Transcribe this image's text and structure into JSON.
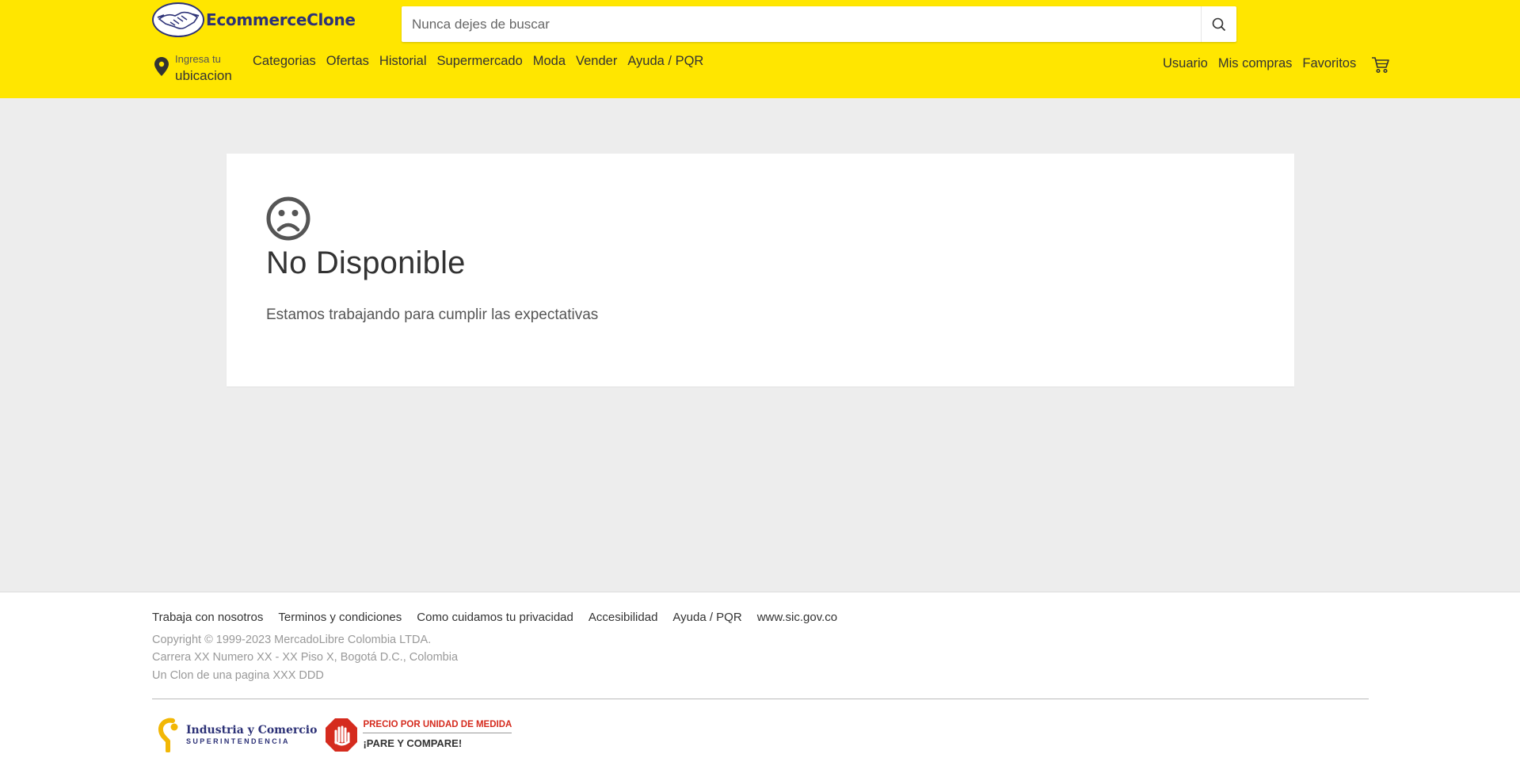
{
  "header": {
    "brand": "EcommerceClone",
    "search_placeholder": "Nunca dejes de buscar",
    "location_line1": "Ingresa tu",
    "location_line2": "ubicacion",
    "nav_items": [
      "Categorias",
      "Ofertas",
      "Historial",
      "Supermercado",
      "Moda",
      "Vender",
      "Ayuda / PQR"
    ],
    "right_items": [
      "Usuario",
      "Mis compras",
      "Favoritos"
    ],
    "accent_color": "#ffe600",
    "brand_color": "#2d3277"
  },
  "main": {
    "icon": "sad-face-icon",
    "title": "No Disponible",
    "description": "Estamos trabajando para cumplir las expectativas"
  },
  "footer": {
    "links": [
      "Trabaja con nosotros",
      "Terminos y condiciones",
      "Como cuidamos tu privacidad",
      "Accesibilidad",
      "Ayuda / PQR",
      "www.sic.gov.co"
    ],
    "copyright": "Copyright © 1999-2023 MercadoLibre Colombia LTDA.",
    "address": "Carrera XX Numero XX - XX Piso X, Bogotá D.C., Colombia",
    "note": "Un Clon de una pagina XXX DDD",
    "sic_line1": "Industria y Comercio",
    "sic_line2": "SUPERINTENDENCIA",
    "pare_line1": "PRECIO POR UNIDAD DE MEDIDA",
    "pare_line2": "¡PARE Y COMPARE!"
  }
}
